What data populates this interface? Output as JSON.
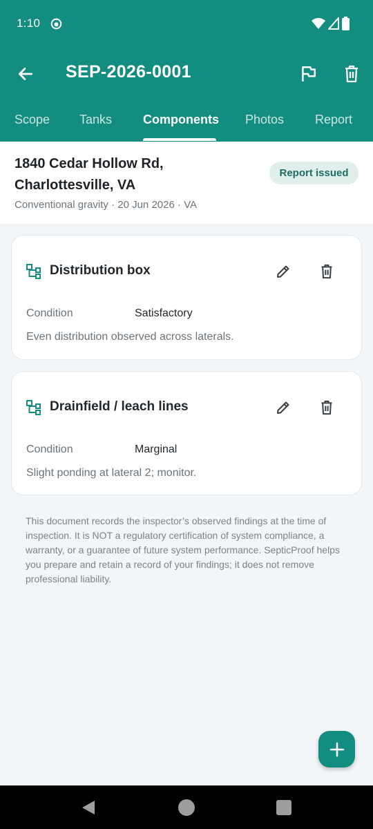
{
  "status_bar": {
    "time": "1:10",
    "icons": [
      "notification-icon",
      "wifi-icon",
      "signal-icon",
      "battery-icon"
    ]
  },
  "toolbar": {
    "title": "SEP-2026-0001",
    "icons": [
      "back-arrow-icon",
      "flag-icon",
      "trash-icon"
    ]
  },
  "tabs": [
    {
      "label": "Scope",
      "active": false
    },
    {
      "label": "Tanks",
      "active": false
    },
    {
      "label": "Components",
      "active": true
    },
    {
      "label": "Photos",
      "active": false
    },
    {
      "label": "Report",
      "active": false
    }
  ],
  "header": {
    "address": "1840 Cedar Hollow Rd, Charlottesville, VA",
    "meta": "Conventional gravity · 20 Jun 2026 · VA",
    "badge": "Report issued"
  },
  "components": [
    {
      "name": "Distribution box",
      "condition_label": "Condition",
      "condition": "Satisfactory",
      "note": "Even distribution observed across laterals."
    },
    {
      "name": "Drainfield / leach lines",
      "condition_label": "Condition",
      "condition": "Marginal",
      "note": "Slight ponding at lateral 2; monitor."
    }
  ],
  "disclaimer": "This document records the inspector’s observed findings at the time of inspection. It is NOT a regulatory certification of system compliance, a warranty, or a guarantee of future system performance. SepticProof helps you prepare and retain a record of your findings; it does not remove professional liability.",
  "colors": {
    "primary": "#138d80",
    "badge_bg": "#e1efec",
    "badge_text": "#1c6e63",
    "background": "#f3f6f8"
  },
  "fab": {
    "icon": "plus-icon"
  }
}
